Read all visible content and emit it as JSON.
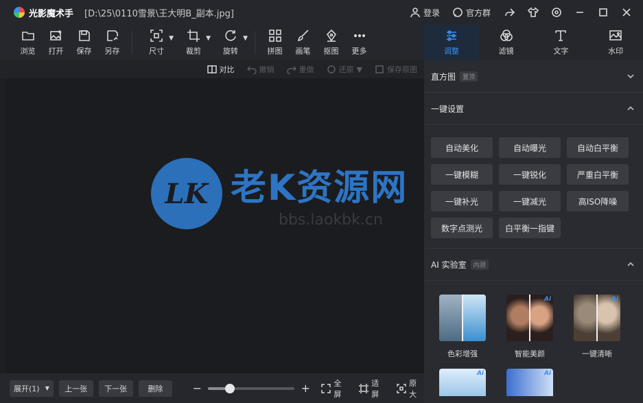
{
  "app": {
    "name": "光影魔术手",
    "file_path": "[D:\\25\\0110雪景\\王大明B_副本.jpg]"
  },
  "titlebar": {
    "login_label": "登录",
    "group_label": "官方群",
    "icons": [
      "user-icon",
      "chat-icon",
      "share-icon",
      "tshirt-icon",
      "settings-icon",
      "minimize-icon",
      "maximize-icon",
      "close-icon"
    ]
  },
  "toolbar": {
    "tools": [
      {
        "id": "browse",
        "label": "浏览",
        "icon": "folder-icon"
      },
      {
        "id": "open",
        "label": "打开",
        "icon": "image-open-icon"
      },
      {
        "id": "save",
        "label": "保存",
        "icon": "save-icon"
      },
      {
        "id": "save_as",
        "label": "另存",
        "icon": "save-as-icon"
      },
      {
        "id": "size",
        "label": "尺寸",
        "icon": "resize-icon"
      },
      {
        "id": "crop",
        "label": "裁剪",
        "icon": "crop-icon"
      },
      {
        "id": "rotate",
        "label": "旋转",
        "icon": "rotate-icon"
      },
      {
        "id": "collage",
        "label": "拼图",
        "icon": "collage-icon"
      },
      {
        "id": "brush",
        "label": "画笔",
        "icon": "brush-icon"
      },
      {
        "id": "cutout",
        "label": "抠图",
        "icon": "pen-icon"
      },
      {
        "id": "more",
        "label": "更多",
        "icon": "more-icon"
      }
    ]
  },
  "subbar": {
    "compare": "对比",
    "undo": "撤销",
    "redo": "重做",
    "restore": "还原",
    "history": "保存原图"
  },
  "watermark": {
    "logo_text": "LK",
    "title": "老K资源网",
    "url": "bbs.laokbk.cn"
  },
  "bottombar": {
    "expand_label": "展开(1)",
    "prev_label": "上一张",
    "next_label": "下一张",
    "delete_label": "删除",
    "zoom_fraction": 0.25,
    "fullscreen_label": "全屏",
    "fit_label": "适屏",
    "original_label": "原大"
  },
  "panel": {
    "tabs": [
      {
        "label": "调整",
        "icon": "sliders-icon",
        "active": true
      },
      {
        "label": "滤镜",
        "icon": "filter-icon",
        "active": false
      },
      {
        "label": "文字",
        "icon": "text-icon",
        "active": false
      },
      {
        "label": "水印",
        "icon": "watermark-icon",
        "active": false
      }
    ],
    "histogram": {
      "title": "直方图",
      "tag": "置顶"
    },
    "one_click": {
      "title": "一键设置",
      "buttons": [
        "自动美化",
        "自动曝光",
        "自动白平衡",
        "一键模糊",
        "一键锐化",
        "严重白平衡",
        "一键补光",
        "一键减光",
        "高ISO降噪",
        "数字点测光",
        "白平衡一指键"
      ]
    },
    "ai_lab": {
      "title": "AI 实验室",
      "tag": "内测",
      "badge": "Ai",
      "items": [
        "色彩增强",
        "智能美颜",
        "一键清晰"
      ]
    }
  },
  "colors": {
    "accent": "#3b8ff0",
    "background": "#1e1f23",
    "panel": "#2a2b30",
    "button": "#3a3c42"
  }
}
